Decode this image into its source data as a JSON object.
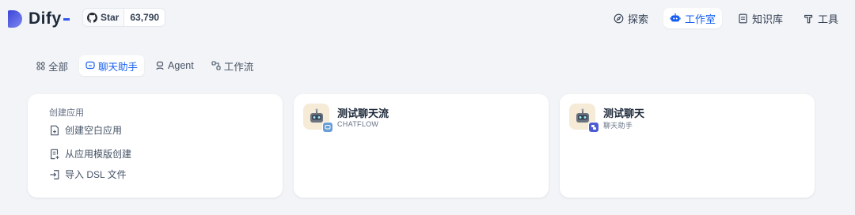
{
  "brand": {
    "name": "Dify",
    "accent": "#155eef"
  },
  "github": {
    "star_label": "Star",
    "star_count": "63,790"
  },
  "nav": [
    {
      "label": "探索",
      "icon": "compass-icon"
    },
    {
      "label": "工作室",
      "icon": "robot-icon",
      "active": true
    },
    {
      "label": "知识库",
      "icon": "book-icon"
    },
    {
      "label": "工具",
      "icon": "hammer-icon"
    }
  ],
  "tabs": [
    {
      "label": "全部",
      "icon": "grid-icon"
    },
    {
      "label": "聊天助手",
      "icon": "chat-icon",
      "active": true
    },
    {
      "label": "Agent",
      "icon": "agent-icon"
    },
    {
      "label": "工作流",
      "icon": "workflow-icon"
    }
  ],
  "create": {
    "title": "创建应用",
    "items": [
      {
        "label": "创建空白应用",
        "icon": "file-plus-icon"
      },
      {
        "label": "从应用模版创建",
        "icon": "template-icon"
      },
      {
        "label": "导入 DSL 文件",
        "icon": "import-icon"
      }
    ]
  },
  "apps": [
    {
      "name": "测试聊天流",
      "type": "CHATFLOW",
      "badge_color": "#6a9fd6"
    },
    {
      "name": "测试聊天",
      "type": "聊天助手",
      "badge_color": "#4c5bd4"
    }
  ]
}
